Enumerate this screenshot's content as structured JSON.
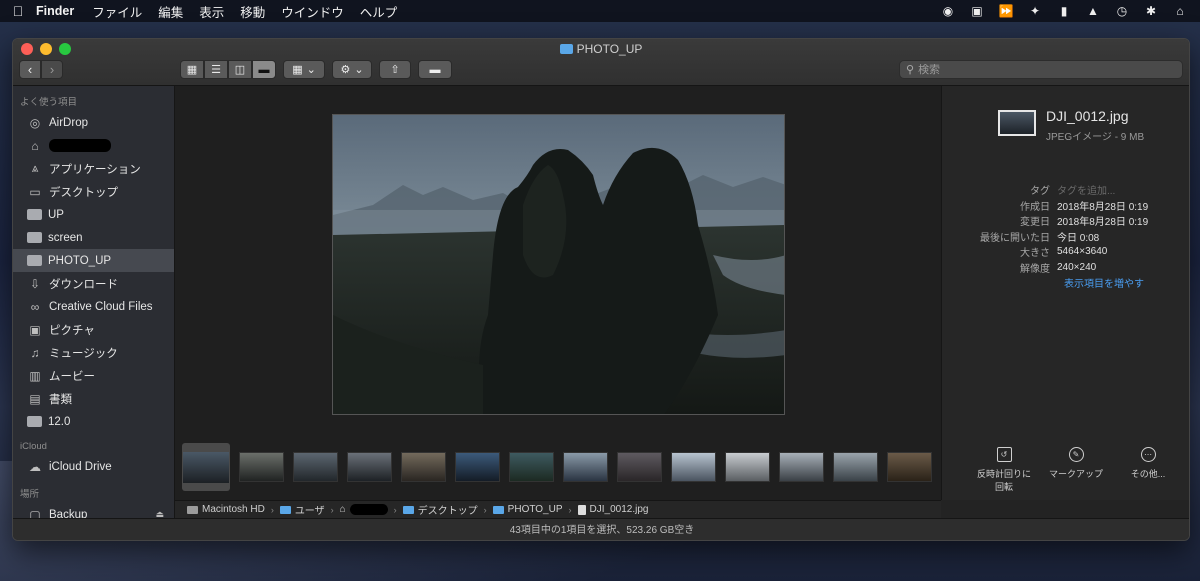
{
  "menubar": {
    "app_name": "Finder",
    "items": [
      "ファイル",
      "編集",
      "表示",
      "移動",
      "ウインドウ",
      "ヘルプ"
    ]
  },
  "window": {
    "title": "PHOTO_UP",
    "search_placeholder": "検索"
  },
  "sidebar": {
    "favorites_header": "よく使う項目",
    "favorites": [
      {
        "label": "AirDrop",
        "icon": "airdrop-icon"
      },
      {
        "label": "",
        "icon": "home-icon",
        "redacted": true
      },
      {
        "label": "アプリケーション",
        "icon": "applications-icon"
      },
      {
        "label": "デスクトップ",
        "icon": "desktop-icon"
      },
      {
        "label": "UP",
        "icon": "folder-icon"
      },
      {
        "label": "screen",
        "icon": "folder-icon"
      },
      {
        "label": "PHOTO_UP",
        "icon": "folder-icon",
        "selected": true
      },
      {
        "label": "ダウンロード",
        "icon": "download-icon"
      },
      {
        "label": "Creative Cloud Files",
        "icon": "creative-cloud-icon"
      },
      {
        "label": "ピクチャ",
        "icon": "pictures-icon"
      },
      {
        "label": "ミュージック",
        "icon": "music-icon"
      },
      {
        "label": "ムービー",
        "icon": "movies-icon"
      },
      {
        "label": "書類",
        "icon": "documents-icon"
      },
      {
        "label": "12.0",
        "icon": "folder-icon"
      }
    ],
    "icloud_header": "iCloud",
    "icloud": [
      {
        "label": "iCloud Drive",
        "icon": "cloud-icon"
      }
    ],
    "locations_header": "場所",
    "locations": [
      {
        "label": "Backup",
        "icon": "disk-icon"
      }
    ]
  },
  "pathbar": {
    "segments": [
      "Macintosh HD",
      "ユーザ",
      "",
      "デスクトップ",
      "PHOTO_UP",
      "DJI_0012.jpg"
    ]
  },
  "inspector": {
    "file_name": "DJI_0012.jpg",
    "file_kind": "JPEGイメージ - 9 MB",
    "meta": [
      {
        "key": "タグ",
        "value": "タグを追加...",
        "placeholder": true
      },
      {
        "key": "作成日",
        "value": "2018年8月28日 0:19"
      },
      {
        "key": "変更日",
        "value": "2018年8月28日 0:19"
      },
      {
        "key": "最後に開いた日",
        "value": "今日 0:08"
      },
      {
        "key": "大きさ",
        "value": "5464×3640"
      },
      {
        "key": "解像度",
        "value": "240×240"
      }
    ],
    "show_more": "表示項目を増やす",
    "actions": [
      {
        "label": "反時計回りに回転",
        "icon": "rotate-left-icon"
      },
      {
        "label": "マークアップ",
        "icon": "markup-icon"
      },
      {
        "label": "その他...",
        "icon": "more-icon"
      }
    ]
  },
  "statusbar": {
    "text": "43項目中の1項目を選択、523.26 GB空き"
  },
  "colors": {
    "accent_link": "#4a9ef2",
    "folder_blue": "#5aa7e8",
    "sidebar_bg": "#2b2d33",
    "window_bg": "#1f1f1f"
  }
}
